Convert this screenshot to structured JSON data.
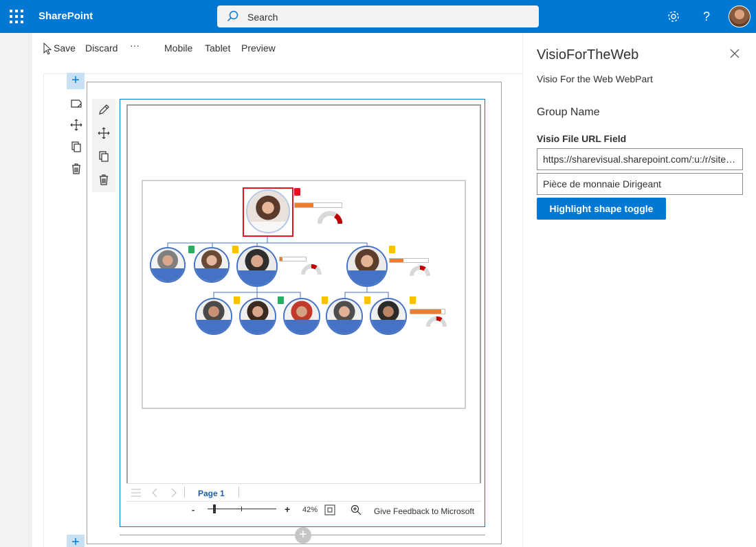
{
  "topbar": {
    "brand": "SharePoint",
    "search_placeholder": "Search"
  },
  "commands": {
    "save": "Save",
    "discard": "Discard",
    "more": "···",
    "mobile": "Mobile",
    "tablet": "Tablet",
    "preview": "Preview"
  },
  "viewer": {
    "page_label": "Page 1",
    "zoom_minus": "-",
    "zoom_plus": "+",
    "zoom_value": "42%",
    "feedback": "Give Feedback to Microsoft"
  },
  "panel": {
    "title": "VisioForTheWeb",
    "description": "Visio For the Web WebPart",
    "group_name": "Group Name",
    "url_label": "Visio File URL Field",
    "url_value": "https://sharevisual.sharepoint.com/:u:/r/sites/...",
    "shape_value": "Pièce de monnaie Dirigeant",
    "button": "Highlight shape toggle"
  },
  "colors": {
    "brand_blue": "#0078d4",
    "node_blue": "#4472c4",
    "highlight_red": "#e81123",
    "progress_orange": "#ed7d31",
    "check_green": "#27ae60",
    "badge_yellow": "#ffc000"
  },
  "icons": {
    "waffle": "waffle-icon",
    "search": "search-icon",
    "settings": "gear-icon",
    "help": "help-icon",
    "close": "close-icon"
  }
}
